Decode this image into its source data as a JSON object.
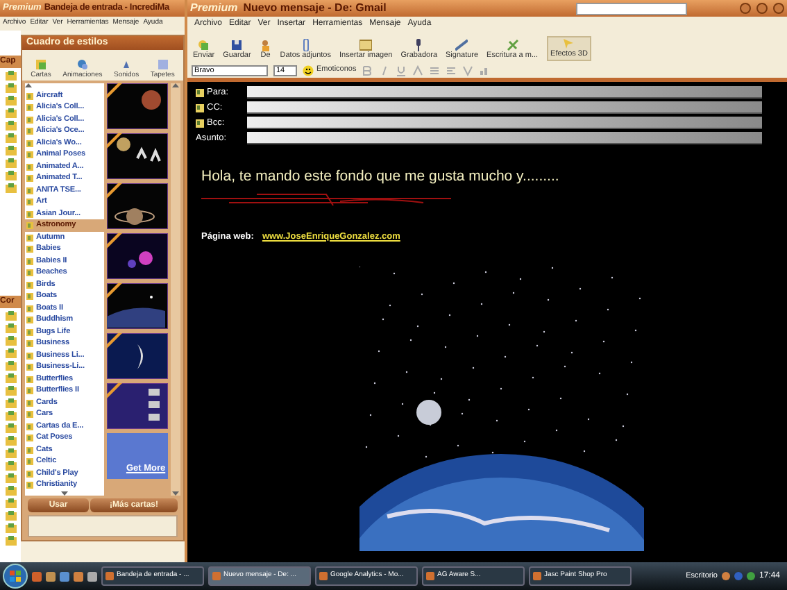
{
  "inbox_window": {
    "title_brand": "Premium",
    "title": "Bandeja de entrada - IncrediMa",
    "menu": [
      "Archivo",
      "Editar",
      "Ver",
      "Herramientas",
      "Mensaje",
      "Ayuda"
    ],
    "sidebar_labels": [
      "Cap",
      "Cor"
    ]
  },
  "styles_panel": {
    "title": "Cuadro de estilos",
    "tabs": [
      "Cartas",
      "Animaciones",
      "Sonidos",
      "Tapetes"
    ],
    "categories": [
      {
        "label": "Aircraft",
        "selected": false
      },
      {
        "label": "Alicia's Coll...",
        "selected": false
      },
      {
        "label": "Alicia's Coll...",
        "selected": false
      },
      {
        "label": "Alicia's Oce...",
        "selected": false
      },
      {
        "label": "Alicia's Wo...",
        "selected": false
      },
      {
        "label": "Animal Poses",
        "selected": false
      },
      {
        "label": "Animated A...",
        "selected": false
      },
      {
        "label": "Animated T...",
        "selected": false
      },
      {
        "label": "ANITA TSE...",
        "selected": false
      },
      {
        "label": "Art",
        "selected": false
      },
      {
        "label": "Asian Jour...",
        "selected": false
      },
      {
        "label": "Astronomy",
        "selected": true
      },
      {
        "label": "Autumn",
        "selected": false
      },
      {
        "label": "Babies",
        "selected": false
      },
      {
        "label": "Babies II",
        "selected": false
      },
      {
        "label": "Beaches",
        "selected": false
      },
      {
        "label": "Birds",
        "selected": false
      },
      {
        "label": "Boats",
        "selected": false
      },
      {
        "label": "Boats II",
        "selected": false
      },
      {
        "label": "Buddhism",
        "selected": false
      },
      {
        "label": "Bugs Life",
        "selected": false
      },
      {
        "label": "Business",
        "selected": false
      },
      {
        "label": "Business Li...",
        "selected": false
      },
      {
        "label": "Business-Li...",
        "selected": false
      },
      {
        "label": "Butterflies",
        "selected": false
      },
      {
        "label": "Butterflies II",
        "selected": false
      },
      {
        "label": "Cards",
        "selected": false
      },
      {
        "label": "Cars",
        "selected": false
      },
      {
        "label": "Cartas da E...",
        "selected": false
      },
      {
        "label": "Cat Poses",
        "selected": false
      },
      {
        "label": "Cats",
        "selected": false
      },
      {
        "label": "Celtic",
        "selected": false
      },
      {
        "label": "Child's Play",
        "selected": false
      },
      {
        "label": "Christianity",
        "selected": false
      }
    ],
    "get_more": "Get More",
    "buttons": [
      "Usar",
      "¡Más cartas!"
    ]
  },
  "message_window": {
    "title_brand": "Premium",
    "title": "Nuevo mensaje - De: Gmail",
    "menu": [
      "Archivo",
      "Editar",
      "Ver",
      "Insertar",
      "Herramientas",
      "Mensaje",
      "Ayuda"
    ],
    "toolbar": [
      "Enviar",
      "Guardar",
      "De",
      "Datos adjuntos",
      "Insertar imagen",
      "Grabadora",
      "Signature",
      "Escritura a m...",
      "Efectos 3D"
    ],
    "font": "Bravo",
    "size": "14",
    "emoticons": "Emoticonos",
    "fields": [
      {
        "label": "Para:",
        "kind": "address"
      },
      {
        "label": "CC:",
        "kind": "address"
      },
      {
        "label": "Bcc:",
        "kind": "address"
      },
      {
        "label": "Asunto:",
        "kind": "subject"
      }
    ],
    "body": {
      "greeting": "Hola, te mando este fondo que me gusta mucho y.........",
      "web_label": "Página web:",
      "web_link": "www.JoseEnriqueGonzalez.com"
    }
  },
  "taskbar": {
    "tasks": [
      {
        "label": "Bandeja de entrada - ...",
        "selected": false
      },
      {
        "label": "Nuevo mensaje - De: ...",
        "selected": true
      },
      {
        "label": "Google Analytics - Mo...",
        "selected": false
      },
      {
        "label": "AG Aware S...",
        "selected": false
      },
      {
        "label": "Jasc Paint Shop Pro",
        "selected": false
      }
    ],
    "tray_label": "Escritorio",
    "clock": "17:44"
  }
}
